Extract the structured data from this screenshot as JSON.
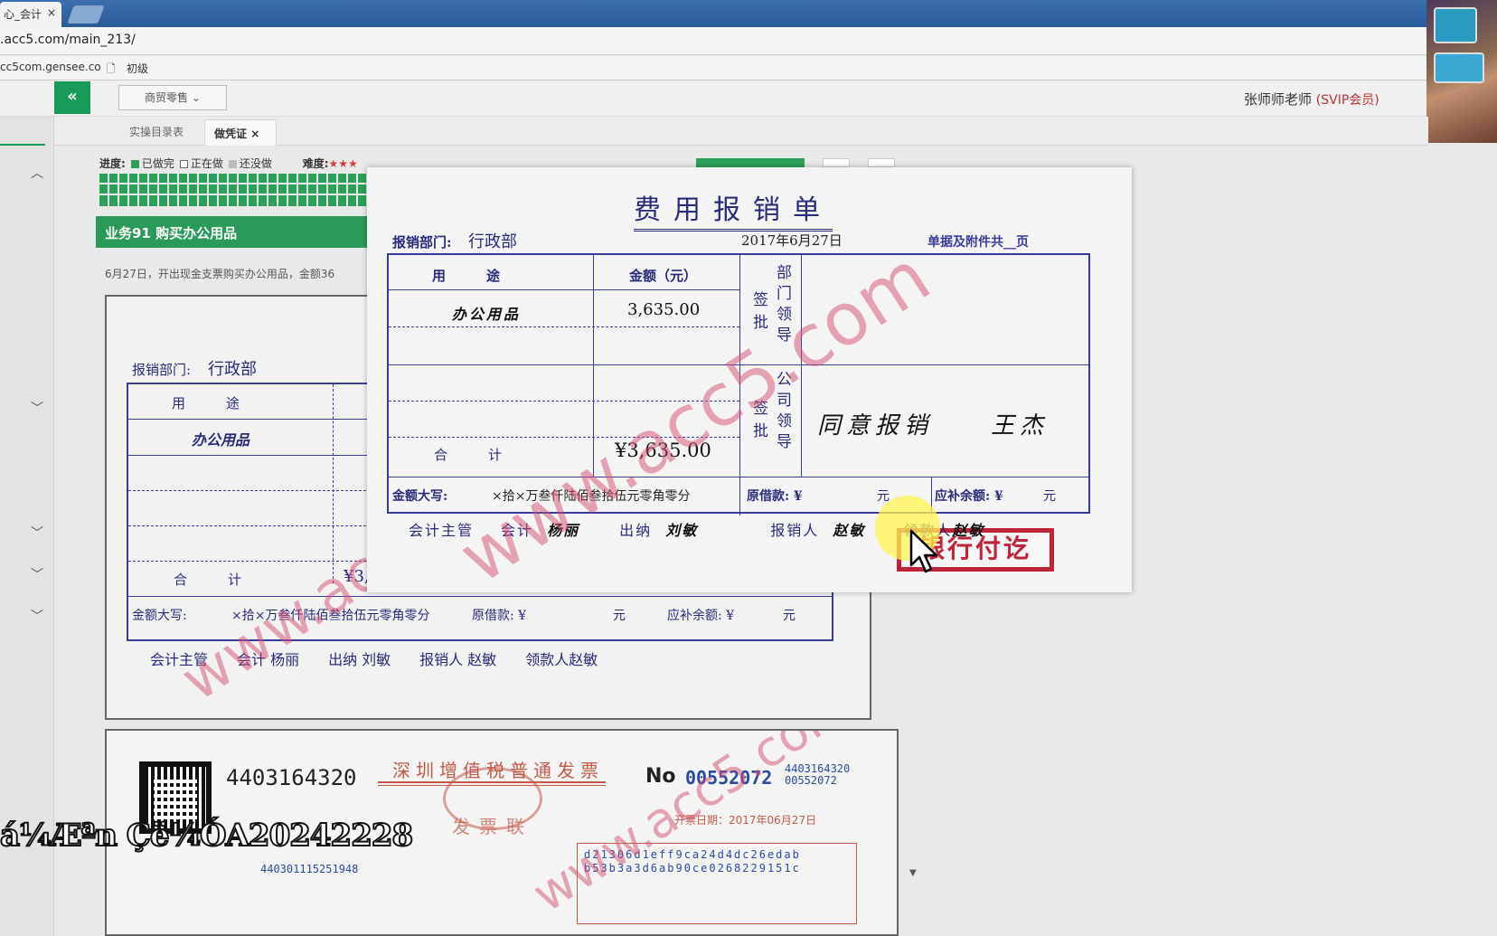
{
  "browser": {
    "tab_title": "心_会计",
    "tab_close": "×",
    "url": ".acc5.com/main_213/",
    "bookmarks": [
      "cc5com.gensee.co",
      "初级"
    ]
  },
  "app": {
    "collapse_label": "«",
    "mode_select": "商贸零售",
    "user_name": "张师师老师",
    "user_badge": "(SVIP会员)",
    "tabs": [
      {
        "label": "实操目录表"
      },
      {
        "label": "做凭证",
        "close": "×"
      }
    ],
    "progress": {
      "label": "进度:",
      "done": "已做完",
      "doing": "正在做",
      "todo": "还没做",
      "difficulty_label": "难度:",
      "done_color": "#2aa05a"
    },
    "task_title": "业务91 购买办公用品",
    "task_desc": "6月27日，开出现金支票购买办公用品，金额36"
  },
  "background_voucher": {
    "dept_label": "报销部门:",
    "dept": "行政部",
    "col_use": "用　　　途",
    "item": "办公用品",
    "total_label": "合　　　计",
    "total_partial": "¥3,635.00",
    "daxie_label": "金额大写:",
    "daxie": "×拾×万叁仟陆佰叁拾伍元零角零分",
    "loan_label": "原借款: ¥",
    "yuan": "元",
    "balance_label": "应补余额: ¥",
    "signers": "会计主管　　会计 杨丽　　出纳 刘敏　　报销人 赵敏　　领款人赵敏"
  },
  "popup_voucher": {
    "title": "费用报销单",
    "dept_label": "报销部门:",
    "dept": "行政部",
    "date": "2017年6月27日",
    "attachments": "单据及附件共__页",
    "col_use": "用　　　途",
    "col_amount": "金额（元）",
    "dept_leader_sign": [
      "签批",
      "部门领导"
    ],
    "company_leader_sign": [
      "签批",
      "公司领导"
    ],
    "item": "办公用品",
    "amount": "3,635.00",
    "total_label": "合　　　计",
    "total": "¥3,635.00",
    "approval_text": "同意报销　　王杰",
    "stamp": "银行付讫",
    "daxie_label": "金额大写:",
    "daxie": "×拾×万叁仟陆佰叁拾伍元零角零分",
    "loan_label": "原借款: ¥",
    "yuan": "元",
    "balance_label": "应补余额: ¥",
    "signers": {
      "supervisor": "会计主管",
      "accountant_label": "会计",
      "accountant": "杨丽",
      "cashier_label": "出纳",
      "cashier": "刘敏",
      "claimant_label": "报销人",
      "claimant": "赵敏",
      "receiver_label": "领款人",
      "receiver": "赵敏"
    }
  },
  "invoice": {
    "code": "4403164320",
    "title": "深圳增值税普通发票",
    "copy": "发票联",
    "no_label": "No",
    "number": "00552072",
    "small_code": "4403164320",
    "small_number": "00552072",
    "date": "开票日期：2017年06月27日",
    "cipher_1": "d21306d1eff9ca24d4dc26edab",
    "cipher_2": "b53b3a3d6ab90ce0268229151c",
    "tax_id": "440301115251948"
  },
  "watermark": "www.acc5.com",
  "overlay_text": "á¼Æªn Çë¼ÓA20242228"
}
